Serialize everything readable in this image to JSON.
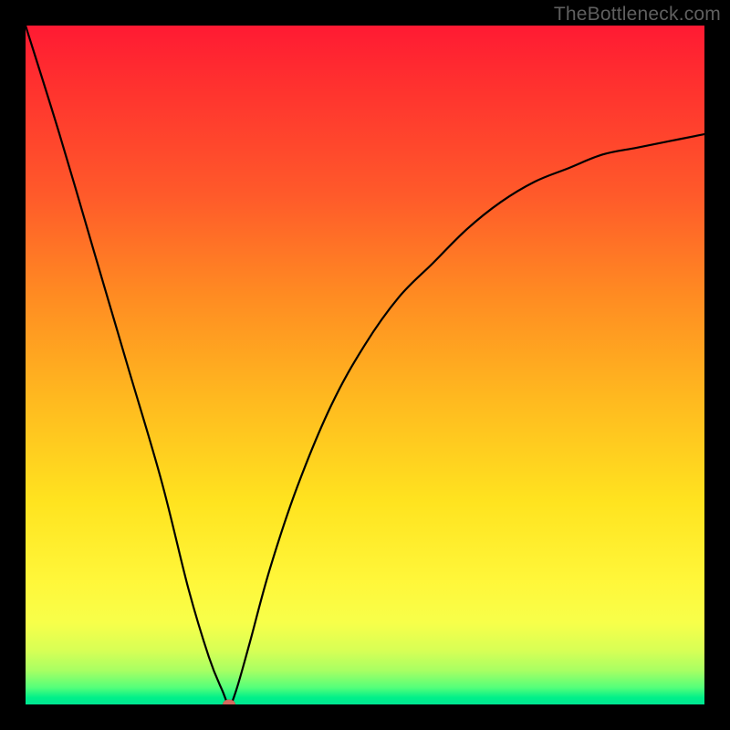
{
  "watermark": {
    "text": "TheBottleneck.com"
  },
  "chart_data": {
    "type": "line",
    "title": "",
    "xlabel": "",
    "ylabel": "",
    "xlim": [
      0,
      100
    ],
    "ylim": [
      0,
      100
    ],
    "grid": false,
    "legend": false,
    "background_gradient": {
      "orientation": "vertical",
      "stops": [
        {
          "pos": 0.0,
          "color": "#ff1a33"
        },
        {
          "pos": 0.25,
          "color": "#ff5a2a"
        },
        {
          "pos": 0.55,
          "color": "#ffb91f"
        },
        {
          "pos": 0.82,
          "color": "#fff73a"
        },
        {
          "pos": 0.95,
          "color": "#a8ff63"
        },
        {
          "pos": 1.0,
          "color": "#00e693"
        }
      ]
    },
    "series": [
      {
        "name": "bottleneck-curve",
        "color": "#000000",
        "x": [
          0,
          5,
          10,
          15,
          20,
          24,
          27,
          29,
          30,
          31,
          33,
          36,
          40,
          45,
          50,
          55,
          60,
          65,
          70,
          75,
          80,
          85,
          90,
          95,
          100
        ],
        "values": [
          100,
          84,
          67,
          50,
          33,
          17,
          7,
          2,
          0,
          2,
          9,
          20,
          32,
          44,
          53,
          60,
          65,
          70,
          74,
          77,
          79,
          81,
          82,
          83,
          84
        ]
      }
    ],
    "marker": {
      "name": "optimum-point",
      "x": 30,
      "y": 0,
      "color": "#d46a5e"
    }
  }
}
